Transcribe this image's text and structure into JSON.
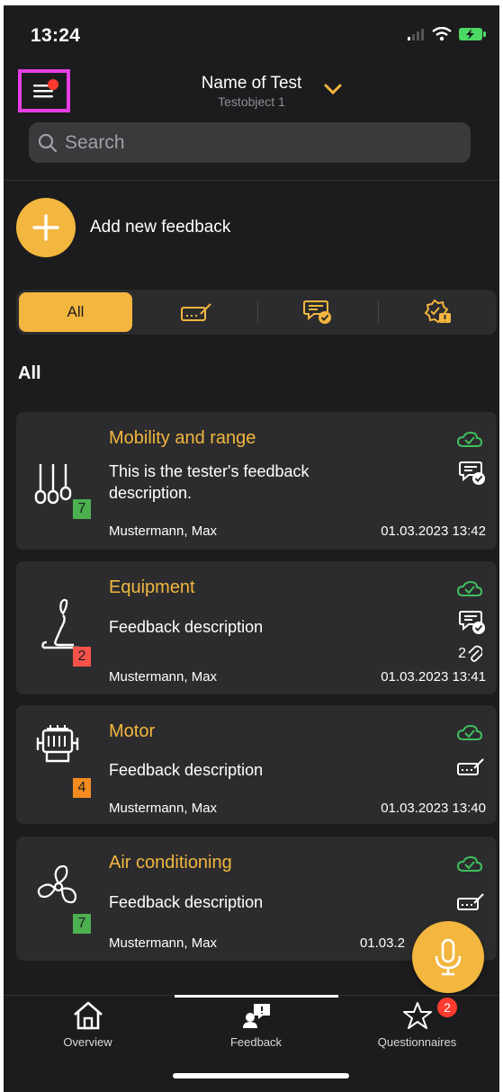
{
  "status": {
    "time": "13:24"
  },
  "header": {
    "title": "Name of Test",
    "subtitle": "Testobject 1"
  },
  "search": {
    "placeholder": "Search"
  },
  "add_feedback": {
    "label": "Add new feedback"
  },
  "filter": {
    "tabs": [
      {
        "label": "All",
        "active": true,
        "icon": ""
      },
      {
        "label": "",
        "icon": "signature-icon"
      },
      {
        "label": "",
        "icon": "message-check-icon"
      },
      {
        "label": "",
        "icon": "badge-alert-icon"
      }
    ]
  },
  "section": {
    "title": "All"
  },
  "accent_color": "#f3b63f",
  "cards": [
    {
      "title": "Mobility and range",
      "description": "This is the tester's feedback description.",
      "author": "Mustermann, Max",
      "date": "01.03.2023 13:42",
      "rating": "7",
      "rating_color": "#4caf50",
      "icon": "sliders-icon",
      "type_icon": "message-check-icon",
      "attachments": ""
    },
    {
      "title": "Equipment",
      "description": "Feedback description",
      "author": "Mustermann, Max",
      "date": "01.03.2023 13:41",
      "rating": "2",
      "rating_color": "#f5524b",
      "icon": "seat-icon",
      "type_icon": "message-check-icon",
      "attachments": "2"
    },
    {
      "title": "Motor",
      "description": "Feedback description",
      "author": "Mustermann, Max",
      "date": "01.03.2023 13:40",
      "rating": "4",
      "rating_color": "#f28c1e",
      "icon": "engine-icon",
      "type_icon": "signature-icon",
      "attachments": ""
    },
    {
      "title": "Air conditioning",
      "description": "Feedback description",
      "author": "Mustermann, Max",
      "date": "01.03.2",
      "rating": "7",
      "rating_color": "#4caf50",
      "icon": "fan-icon",
      "type_icon": "signature-icon",
      "attachments": ""
    }
  ],
  "nav": {
    "tabs": [
      {
        "label": "Overview",
        "icon": "home-icon"
      },
      {
        "label": "Feedback",
        "icon": "feedback-icon",
        "active": true
      },
      {
        "label": "Questionnaires",
        "icon": "star-icon",
        "badge": "2"
      }
    ]
  }
}
